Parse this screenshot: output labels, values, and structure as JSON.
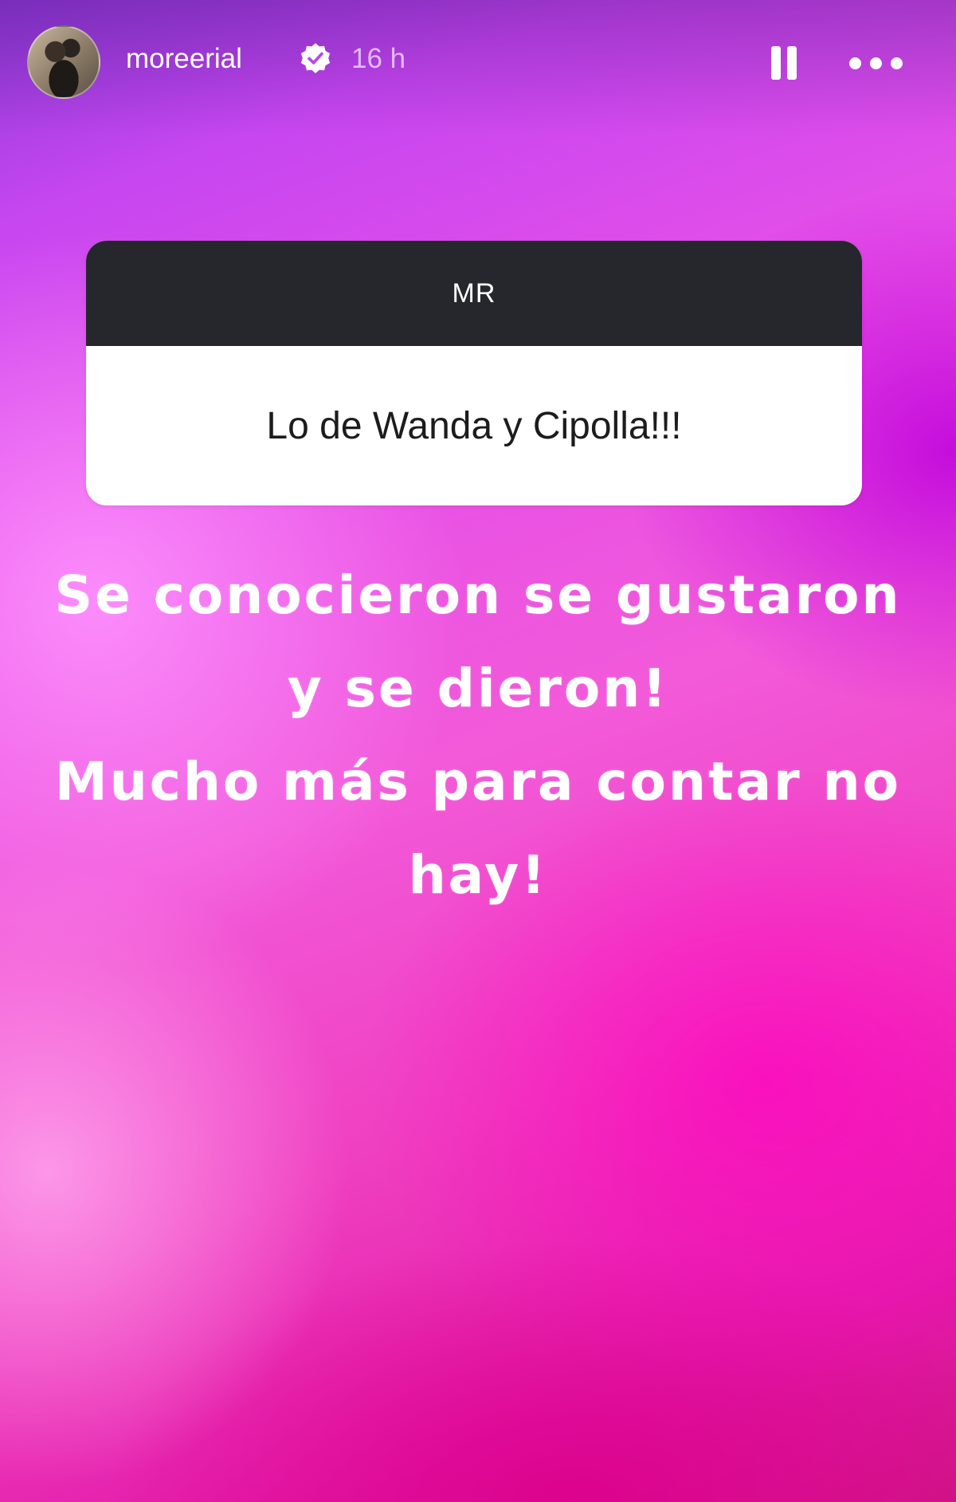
{
  "header": {
    "username": "moreerial",
    "verified": true,
    "timestamp": "16 h",
    "avatar_icon": "profile-photo",
    "pause_icon": "pause-icon",
    "more_icon": "more-horizontal-icon"
  },
  "question_sticker": {
    "title": "MR",
    "question": "Lo de Wanda y Cipolla!!!"
  },
  "caption": {
    "lines": [
      "Se conocieron se gustaron",
      "y se dieron!",
      "Mucho más para contar no",
      "hay!"
    ]
  },
  "colors": {
    "background_top": "#8e3bd8",
    "background_mid": "#f25ad9",
    "background_bottom": "#cf1585",
    "card_header": "#25272c",
    "card_body": "#ffffff"
  }
}
